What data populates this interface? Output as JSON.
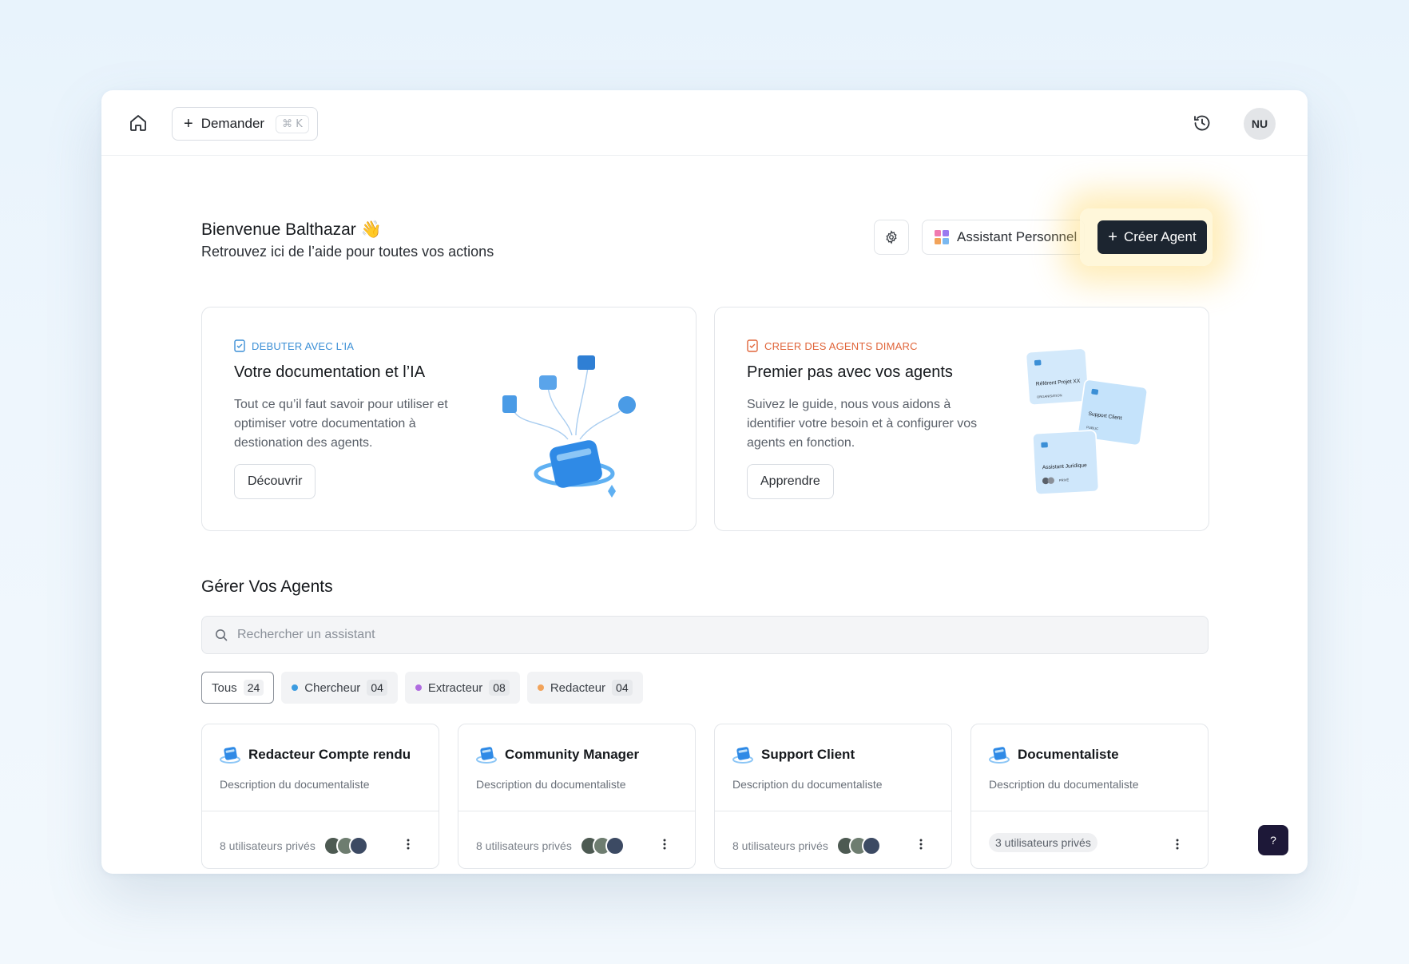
{
  "topbar": {
    "ask_label": "Demander",
    "ask_shortcut": "⌘ K",
    "avatar_initials": "NU"
  },
  "header": {
    "welcome": "Bienvenue Balthazar",
    "welcome_emoji": "👋",
    "subtitle": "Retrouvez ici de l’aide pour toutes vos actions",
    "assistant_label": "Assistant Personnel",
    "create_label": "Créer Agent"
  },
  "promos": [
    {
      "tag": "DEBUTER AVEC L’IA",
      "title": "Votre documentation et l’IA",
      "description": "Tout ce qu’il faut savoir pour utiliser et optimiser votre documentation à destionation des agents.",
      "action": "Découvrir",
      "accent": "#3b8fd6"
    },
    {
      "tag": "CREER DES AGENTS DIMARC",
      "title": "Premier pas avec vos agents",
      "description": "Suivez le guide, nous vous aidons à identifier votre besoin et à configurer vos agents en fonction.",
      "action": "Apprendre",
      "accent": "#e0653a",
      "mini_cards": [
        {
          "title": "Référent Projet XX",
          "badge": "ORGANISATION"
        },
        {
          "title": "Support Client",
          "badge": "PUBLIC"
        },
        {
          "title": "Assistant Juridique",
          "badge": "PRIVÉ"
        }
      ]
    }
  ],
  "agents_section": {
    "title": "Gérer Vos Agents",
    "search_placeholder": "Rechercher un assistant",
    "filters": [
      {
        "label": "Tous",
        "count": "24",
        "active": true
      },
      {
        "label": "Chercheur",
        "count": "04",
        "color": "#3b9be0"
      },
      {
        "label": "Extracteur",
        "count": "08",
        "color": "#b06ce0"
      },
      {
        "label": "Redacteur",
        "count": "04",
        "color": "#f2a35a"
      }
    ],
    "agents": [
      {
        "name": "Redacteur Compte rendu",
        "description": "Description du documentaliste",
        "users": "8 utilisateurs privés"
      },
      {
        "name": "Community Manager",
        "description": "Description du documentaliste",
        "users": "8 utilisateurs privés"
      },
      {
        "name": "Support Client",
        "description": "Description du documentaliste",
        "users": "8 utilisateurs privés"
      },
      {
        "name": "Documentaliste",
        "description": "Description du documentaliste",
        "users": "3 utilisateurs privés"
      }
    ]
  },
  "help_label": "?",
  "colors": {
    "primary_dark": "#1c2530",
    "glow": "#ffd666"
  }
}
